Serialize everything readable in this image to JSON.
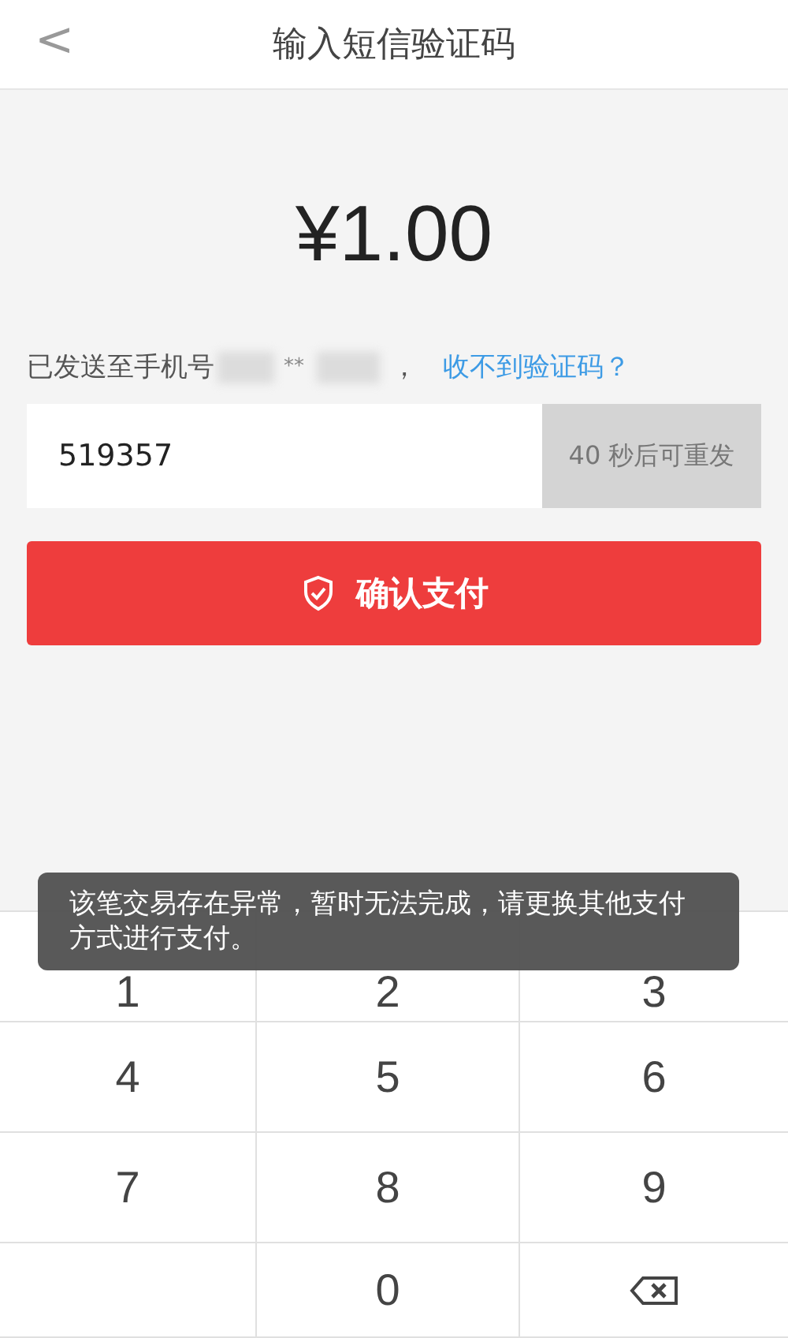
{
  "nav": {
    "back": "<",
    "title": "输入短信验证码"
  },
  "amount": "¥1.00",
  "sent_to": {
    "label": "已发送至手机号",
    "masked_number": "**",
    "separator": "，",
    "help_link": "收不到验证码？"
  },
  "code_field": {
    "value": "519357",
    "resend": "40 秒后可重发",
    "resend_disabled": true
  },
  "confirm_button": {
    "label": "确认支付"
  },
  "toast": "该笔交易存在异常，暂时无法完成，请更换其他支付方式进行支付。",
  "keypad": [
    {
      "kind": "digit",
      "label": "1"
    },
    {
      "kind": "digit",
      "label": "2"
    },
    {
      "kind": "digit",
      "label": "3"
    },
    {
      "kind": "digit",
      "label": "4"
    },
    {
      "kind": "digit",
      "label": "5"
    },
    {
      "kind": "digit",
      "label": "6"
    },
    {
      "kind": "digit",
      "label": "7"
    },
    {
      "kind": "digit",
      "label": "8"
    },
    {
      "kind": "digit",
      "label": "9"
    },
    {
      "kind": "empty"
    },
    {
      "kind": "digit",
      "label": "0"
    },
    {
      "kind": "backspace"
    }
  ]
}
